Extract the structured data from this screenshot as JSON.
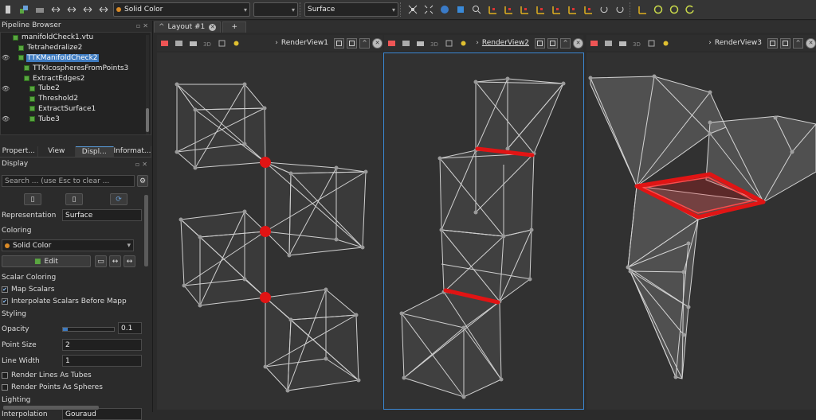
{
  "toolbar": {
    "coloring_value": "Solid Color",
    "component_value": "",
    "representation_value": "Surface"
  },
  "pipeline": {
    "title": "Pipeline Browser",
    "items": [
      {
        "label": "manifoldCheck1.vtu",
        "eye": "",
        "indent": 0,
        "selected": false
      },
      {
        "label": "Tetrahedralize2",
        "eye": "",
        "indent": 1,
        "selected": false
      },
      {
        "label": "TTKManifoldCheck2",
        "eye": "👁",
        "indent": 1,
        "selected": true
      },
      {
        "label": "TTKIcospheresFromPoints3",
        "eye": "",
        "indent": 2,
        "selected": false
      },
      {
        "label": "ExtractEdges2",
        "eye": "",
        "indent": 2,
        "selected": false
      },
      {
        "label": "Tube2",
        "eye": "👁",
        "indent": 3,
        "selected": false
      },
      {
        "label": "Threshold2",
        "eye": "",
        "indent": 3,
        "selected": false
      },
      {
        "label": "ExtractSurface1",
        "eye": "",
        "indent": 3,
        "selected": false
      },
      {
        "label": "Tube3",
        "eye": "👁",
        "indent": 3,
        "selected": false
      }
    ]
  },
  "tabs": [
    "Propert...",
    "View",
    "Displ...",
    "Informat..."
  ],
  "display": {
    "title": "Display",
    "search_placeholder": "Search ... (use Esc to clear ...",
    "representation_label": "Representation",
    "representation_value": "Surface",
    "coloring_header": "Coloring",
    "coloring_value": "Solid Color",
    "edit_label": "Edit",
    "scalar_coloring_header": "Scalar Coloring",
    "map_scalars_label": "Map Scalars",
    "interpolate_label": "Interpolate Scalars Before Mapp",
    "styling_header": "Styling",
    "opacity_label": "Opacity",
    "opacity_value": "0.1",
    "point_size_label": "Point Size",
    "point_size_value": "2",
    "line_width_label": "Line Width",
    "line_width_value": "1",
    "lines_as_tubes_label": "Render Lines As Tubes",
    "points_as_spheres_label": "Render Points As Spheres",
    "lighting_header": "Lighting",
    "interpolation_label": "Interpolation",
    "interpolation_value": "Gouraud"
  },
  "layout": {
    "tab_label": "Layout #1",
    "add_tab": "+"
  },
  "views": [
    {
      "name": "RenderView1"
    },
    {
      "name": "RenderView2"
    },
    {
      "name": "RenderView3"
    }
  ],
  "colors": {
    "accent": "#3e7bc0",
    "critical": "#e11414",
    "active_view_border": "#3b88d4"
  }
}
